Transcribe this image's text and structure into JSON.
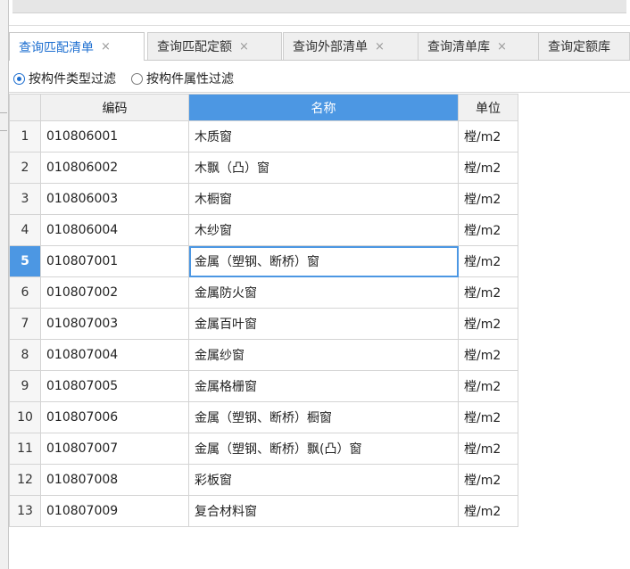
{
  "tabs": [
    {
      "label": "查询匹配清单",
      "close": "×",
      "active": true
    },
    {
      "label": "查询匹配定额",
      "close": "×",
      "active": false
    },
    {
      "label": "查询外部清单",
      "close": "×",
      "active": false
    },
    {
      "label": "查询清单库",
      "close": "×",
      "active": false
    },
    {
      "label": "查询定额库",
      "close": "",
      "active": false
    }
  ],
  "filters": [
    {
      "label": "按构件类型过滤",
      "checked": true
    },
    {
      "label": "按构件属性过滤",
      "checked": false
    }
  ],
  "table": {
    "columns": [
      "编码",
      "名称",
      "单位"
    ],
    "selected_column": 1,
    "current_row": 5,
    "rows": [
      {
        "no": "1",
        "code": "010806001",
        "name": "木质窗",
        "unit": "樘/m2"
      },
      {
        "no": "2",
        "code": "010806002",
        "name": "木飘（凸）窗",
        "unit": "樘/m2"
      },
      {
        "no": "3",
        "code": "010806003",
        "name": "木橱窗",
        "unit": "樘/m2"
      },
      {
        "no": "4",
        "code": "010806004",
        "name": "木纱窗",
        "unit": "樘/m2"
      },
      {
        "no": "5",
        "code": "010807001",
        "name": "金属（塑钢、断桥）窗",
        "unit": "樘/m2"
      },
      {
        "no": "6",
        "code": "010807002",
        "name": "金属防火窗",
        "unit": "樘/m2"
      },
      {
        "no": "7",
        "code": "010807003",
        "name": "金属百叶窗",
        "unit": "樘/m2"
      },
      {
        "no": "8",
        "code": "010807004",
        "name": "金属纱窗",
        "unit": "樘/m2"
      },
      {
        "no": "9",
        "code": "010807005",
        "name": "金属格栅窗",
        "unit": "樘/m2"
      },
      {
        "no": "10",
        "code": "010807006",
        "name": "金属（塑钢、断桥）橱窗",
        "unit": "樘/m2"
      },
      {
        "no": "11",
        "code": "010807007",
        "name": "金属（塑钢、断桥）飘(凸）窗",
        "unit": "樘/m2"
      },
      {
        "no": "12",
        "code": "010807008",
        "name": "彩板窗",
        "unit": "樘/m2"
      },
      {
        "no": "13",
        "code": "010807009",
        "name": "复合材料窗",
        "unit": "樘/m2"
      }
    ]
  }
}
